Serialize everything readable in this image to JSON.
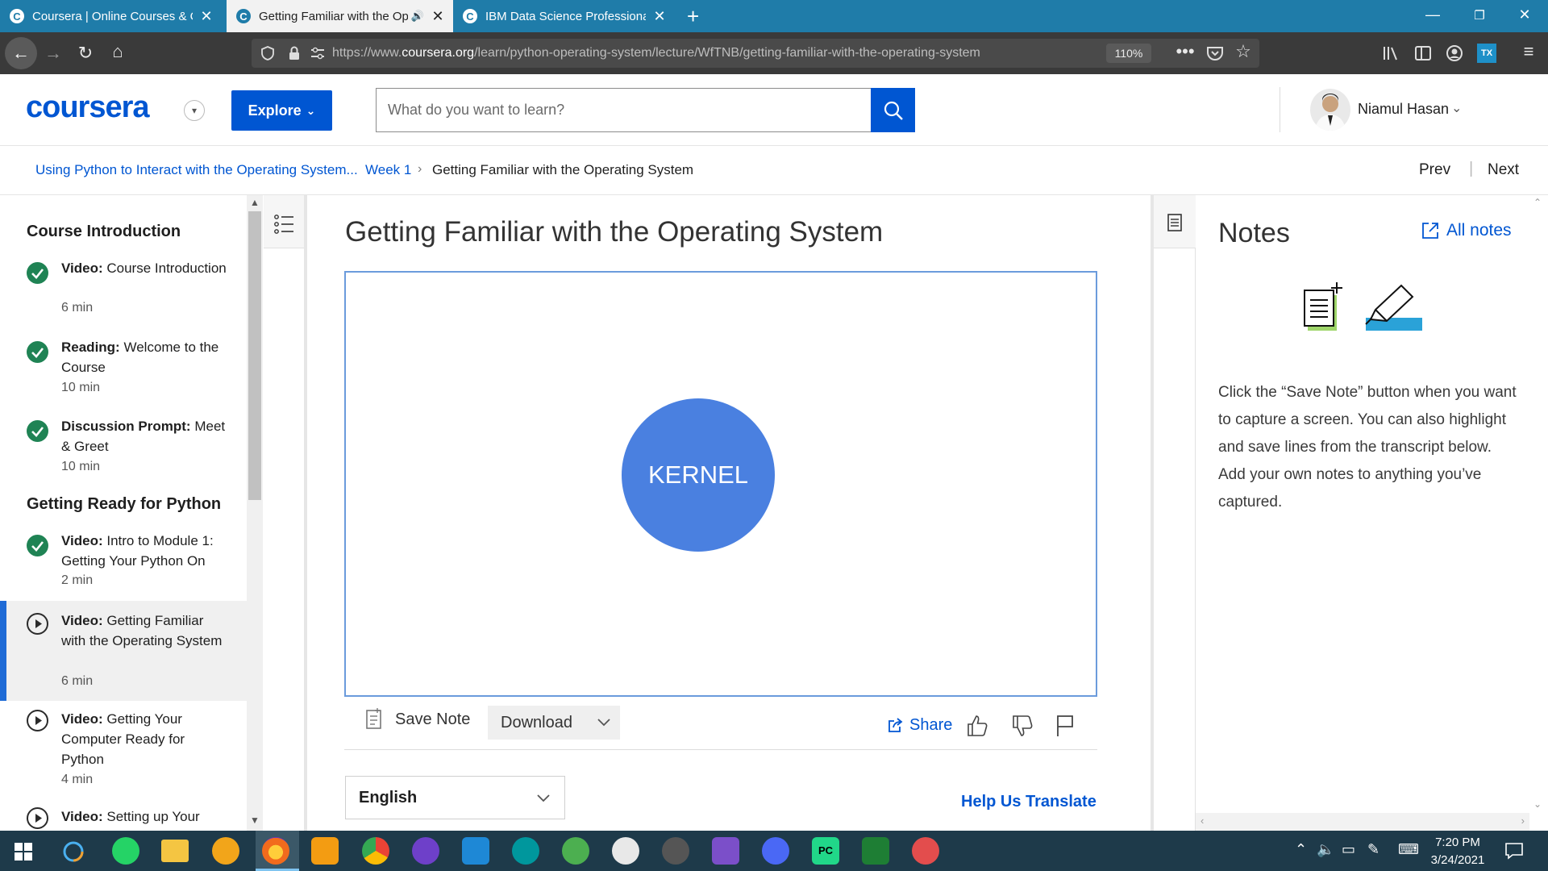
{
  "browser": {
    "tabs": [
      {
        "title": "Coursera | Online Courses & Credentials",
        "favicon": "C"
      },
      {
        "title": "Getting Familiar with the Operating System",
        "favicon": "C"
      },
      {
        "title": "IBM Data Science Professional Certificate",
        "favicon": "C"
      }
    ],
    "url_prefix": "https://www.",
    "url_domain": "coursera.org",
    "url_path": "/learn/python-operating-system/lecture/WfTNB/getting-familiar-with-the-operating-system",
    "zoom": "110%"
  },
  "header": {
    "logo": "coursera",
    "explore_label": "Explore",
    "search_placeholder": "What do you want to learn?",
    "user_name": "Niamul Hasan"
  },
  "breadcrumb": {
    "course": "Using Python to Interact with the Operating System...",
    "week": "Week 1",
    "current": "Getting Familiar with the Operating System",
    "prev": "Prev",
    "next": "Next"
  },
  "sidebar": {
    "sections": [
      {
        "title": "Course Introduction"
      },
      {
        "title": "Getting Ready for Python"
      }
    ],
    "items": [
      {
        "kind": "Video:",
        "name": "Course Introduction",
        "duration": "6 min",
        "status": "completed"
      },
      {
        "kind": "Reading:",
        "name": "Welcome to the Course",
        "duration": "10 min",
        "status": "completed"
      },
      {
        "kind": "Discussion Prompt:",
        "name": "Meet & Greet",
        "duration": "10 min",
        "status": "completed"
      },
      {
        "kind": "Video:",
        "name": "Intro to Module 1: Getting Your Python On",
        "duration": "2 min",
        "status": "completed"
      },
      {
        "kind": "Video:",
        "name": "Getting Familiar with the Operating System",
        "duration": "6 min",
        "status": "current"
      },
      {
        "kind": "Video:",
        "name": "Getting Your Computer Ready for Python",
        "duration": "4 min",
        "status": "not-started"
      },
      {
        "kind": "Video:",
        "name": "Setting up Your",
        "duration": "",
        "status": "not-started"
      }
    ]
  },
  "lecture": {
    "title": "Getting Familiar with the Operating System",
    "video_label": "KERNEL",
    "save_note_label": "Save Note",
    "download_label": "Download",
    "share_label": "Share",
    "language": "English",
    "help_translate": "Help Us Translate"
  },
  "notes": {
    "title": "Notes",
    "all_notes": "All notes",
    "help_text": "Click the “Save Note” button when you want to capture a screen. You can also highlight and save lines from the transcript below. Add your own notes to anything you’ve captured."
  },
  "taskbar": {
    "time": "7:20 PM",
    "date": "3/24/2021"
  },
  "colors": {
    "brand": "#0056d2",
    "completed": "#1f8354",
    "tabbar": "#1f7ca9",
    "kernel": "#4a80e0"
  }
}
